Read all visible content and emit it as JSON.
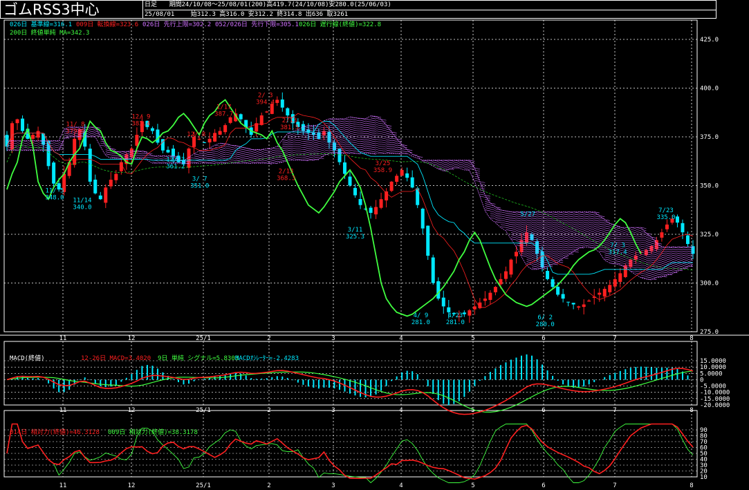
{
  "header": {
    "title": "ゴムRSS3中心",
    "period_type": "日足",
    "period_range": "期間24/10/08～25/08/01(200)",
    "high": "高419.7(24/10/08)",
    "low": "安280.0(25/06/03)",
    "last_date": "25/08/01",
    "ohlc": "始312.3 高316.0 安312.2 終314.8 出636 取3261"
  },
  "main_legend": {
    "kijun": "026日 基準線=316.1",
    "tenkan": "009日 転換線=323.6",
    "senkou_a": "026日 先行上限=302.2",
    "senkou_b": "052/026日 先行下限=305.1",
    "chikou": "026日 遅行線(終値)=322.8",
    "ma": "200日 終値単純 MA=342.3"
  },
  "macd_legend": {
    "name": "MACD(終値)",
    "macd": "12-26日 MACD=3.4020",
    "signal": "9日 単純 シグナル=5.8303",
    "osc": "MACDｵｼﾚｰﾀｰ=-2.4283"
  },
  "rsi_legend": {
    "rsi14": "014日 相対力(終値)=46.3128",
    "rsi9": "009日 相対力(終値)=38.3178"
  },
  "x_labels": [
    "11",
    "12",
    "25/1",
    "2",
    "3",
    "4",
    "5",
    "6",
    "7",
    "8"
  ],
  "colors": {
    "bg": "#000000",
    "up": "#ff2020",
    "down": "#00e8ff",
    "kijun": "#00e8ff",
    "tenkan": "#ff2020",
    "chikou": "#40ff40",
    "ma": "#20c020",
    "cloud": "#d070ff",
    "grid": "#ffffff",
    "macd": "#ff2020",
    "signal": "#40ff40",
    "rsi14": "#ff2020",
    "rsi9": "#40ff40"
  },
  "chart_data": [
    {
      "type": "candlestick",
      "title": "ゴムRSS3中心",
      "ylim": [
        275,
        425
      ],
      "yticks": [
        "425.0",
        "400.0",
        "375.0",
        "350.0",
        "325.0",
        "300.0",
        "275.0"
      ],
      "grid": true,
      "annotations": [
        {
          "label": "11/ 5",
          "value": "348.0",
          "month_pos": 0.0,
          "y": 345
        },
        {
          "label": "11/ 8",
          "value": "379.0",
          "month_pos": 0.3,
          "y": 379
        },
        {
          "label": "11/14",
          "value": "340.0",
          "month_pos": 0.4,
          "y": 340
        },
        {
          "label": "12/ 9",
          "value": "383.4",
          "month_pos": 1.25,
          "y": 383
        },
        {
          "label": "12/23",
          "value": "361.2",
          "month_pos": 1.75,
          "y": 361
        },
        {
          "label": "12/ 8",
          "value": "",
          "month_pos": 2.05,
          "y": 374
        },
        {
          "label": "1/17",
          "value": "387.7",
          "month_pos": 2.45,
          "y": 388
        },
        {
          "label": "3/ 7",
          "value": "351.0",
          "month_pos": 2.1,
          "y": 351
        },
        {
          "label": "2/ 3",
          "value": "394.4",
          "month_pos": 3.05,
          "y": 394
        },
        {
          "label": "2/13",
          "value": "381.5",
          "month_pos": 3.4,
          "y": 381
        },
        {
          "label": "2/13",
          "value": "368.3",
          "month_pos": 3.35,
          "y": 355
        },
        {
          "label": "3/25",
          "value": "358.9",
          "month_pos": 4.75,
          "y": 359
        },
        {
          "label": "3/11",
          "value": "325.3",
          "month_pos": 4.35,
          "y": 325
        },
        {
          "label": "4/ 9",
          "value": "281.0",
          "month_pos": 5.3,
          "y": 281
        },
        {
          "label": "4/23",
          "value": "281.0",
          "month_pos": 5.8,
          "y": 281
        },
        {
          "label": "6/ 2",
          "value": "280.0",
          "month_pos": 7.1,
          "y": 280
        },
        {
          "label": "5/27",
          "value": "",
          "month_pos": 6.85,
          "y": 333
        },
        {
          "label": "7/ 3",
          "value": "317.4",
          "month_pos": 8.15,
          "y": 317
        },
        {
          "label": "7/23",
          "value": "335.0",
          "month_pos": 8.85,
          "y": 335
        }
      ],
      "series": [
        {
          "name": "026日 基準線",
          "values": []
        },
        {
          "name": "009日 転換線",
          "values": []
        },
        {
          "name": "026日 遅行線(終値)",
          "values": []
        },
        {
          "name": "200日 終値単純 MA",
          "values": []
        }
      ],
      "close": [
        370,
        382,
        384,
        378,
        374,
        376,
        378,
        371,
        360,
        351,
        348,
        356,
        362,
        374,
        379,
        370,
        352,
        346,
        343,
        349,
        353,
        356,
        362,
        366,
        369,
        376,
        383,
        380,
        378,
        372,
        368,
        367,
        365,
        362,
        361,
        369,
        375,
        374,
        372,
        374,
        377,
        378,
        381,
        385,
        387,
        384,
        380,
        376,
        382,
        386,
        388,
        392,
        394,
        390,
        386,
        382,
        380,
        378,
        377,
        376,
        374,
        378,
        372,
        368,
        362,
        356,
        350,
        345,
        340,
        338,
        336,
        339,
        343,
        347,
        352,
        355,
        358,
        354,
        349,
        340,
        328,
        314,
        300,
        292,
        288,
        285,
        284,
        283,
        284,
        286,
        288,
        290,
        292,
        295,
        298,
        302,
        306,
        312,
        316,
        322,
        326,
        322,
        315,
        308,
        302,
        298,
        294,
        292,
        290,
        289,
        288,
        289,
        291,
        293,
        295,
        297,
        299,
        302,
        305,
        309,
        312,
        314,
        316,
        317,
        319,
        322,
        326,
        330,
        333,
        331,
        326,
        320,
        315
      ]
    },
    {
      "type": "line",
      "title": "MACD(終値)",
      "ylim": [
        -20,
        15
      ],
      "yticks": [
        "15.0000",
        "10.0000",
        "5.0000",
        "0",
        "-5.0000",
        "-10.0000",
        "-15.0000",
        "-20.0000"
      ],
      "series": [
        {
          "name": "12-26日 MACD",
          "values": []
        },
        {
          "name": "9日 単純 シグナル",
          "values": []
        }
      ]
    },
    {
      "type": "line",
      "title": "相対力",
      "ylim": [
        10,
        90
      ],
      "yticks": [
        "90",
        "80",
        "70",
        "60",
        "50",
        "40",
        "30",
        "20",
        "10"
      ],
      "series": [
        {
          "name": "014日 相対力(終値)",
          "values": []
        },
        {
          "name": "009日 相対力(終値)",
          "values": []
        }
      ]
    }
  ]
}
